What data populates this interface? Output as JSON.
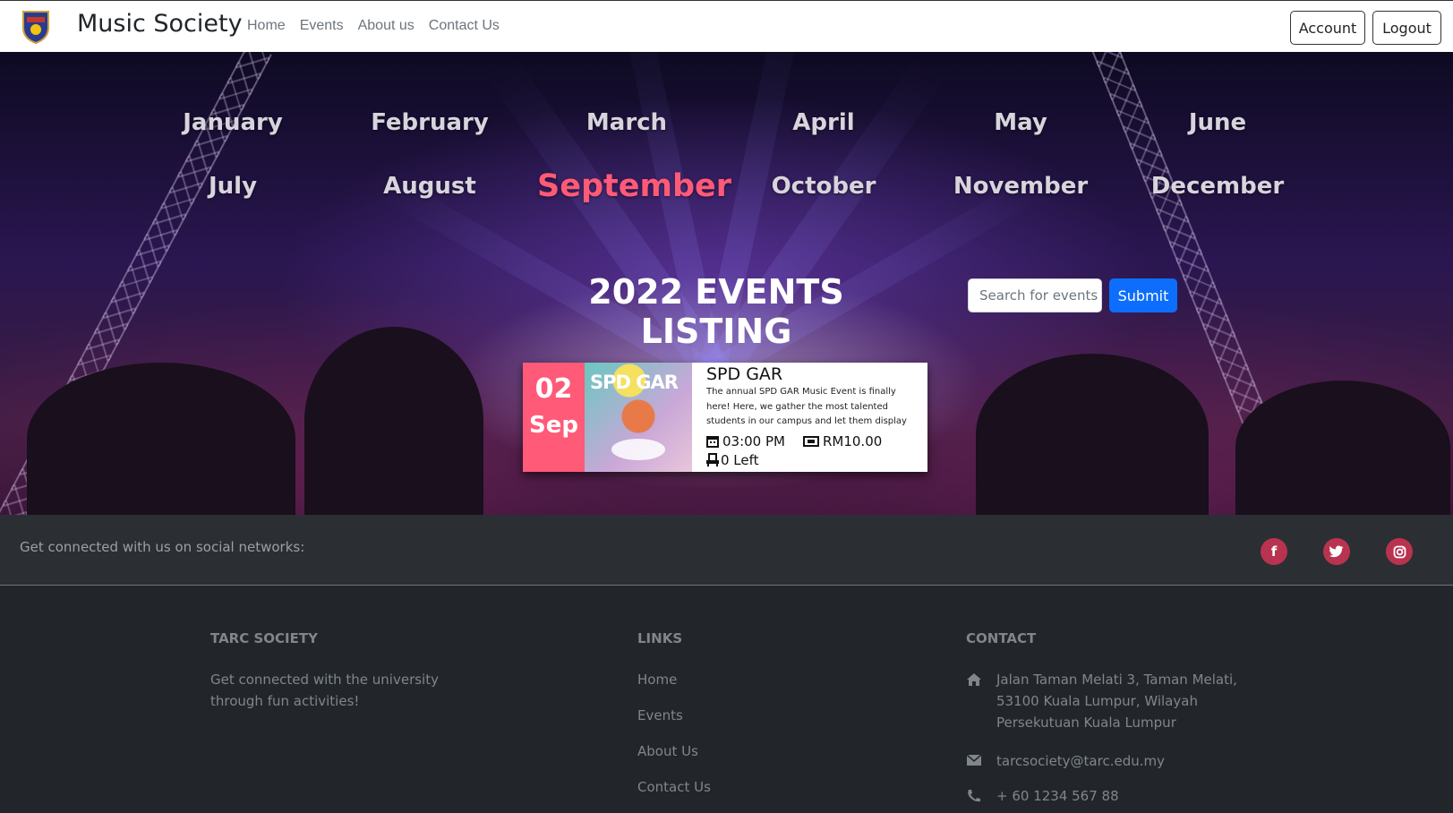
{
  "navbar": {
    "brand": "Music Society",
    "links": [
      "Home",
      "Events",
      "About us",
      "Contact Us"
    ],
    "account_label": "Account",
    "logout_label": "Logout"
  },
  "months": [
    "January",
    "February",
    "March",
    "April",
    "May",
    "June",
    "July",
    "August",
    "September",
    "October",
    "November",
    "December"
  ],
  "active_month": "September",
  "listing_title": "2022 EVENTS LISTING",
  "search": {
    "placeholder": "Search for events",
    "submit_label": "Submit"
  },
  "event": {
    "day": "02",
    "month": "Sep",
    "image_text": "SPD GAR",
    "title": "SPD GAR",
    "description": "The annual SPD GAR Music Event is finally here! Here, we gather the most talented students in our campus and let them display",
    "time": "03:00 PM",
    "price": "RM10.00",
    "seats_left": "0 Left"
  },
  "social": {
    "text": "Get connected with us on social networks:",
    "icons": [
      "facebook-icon",
      "twitter-icon",
      "instagram-icon"
    ]
  },
  "footer": {
    "society": {
      "title": "TARC SOCIETY",
      "text": "Get connected with the university through fun activities!"
    },
    "links": {
      "title": "LINKS",
      "items": [
        "Home",
        "Events",
        "About Us",
        "Contact Us"
      ]
    },
    "contact": {
      "title": "CONTACT",
      "address": "Jalan Taman Melati 3, Taman Melati, 53100 Kuala Lumpur, Wilayah Persekutuan Kuala Lumpur",
      "email": "tarcsociety@tarc.edu.my",
      "phone": "+ 60 1234 567 88"
    }
  },
  "colors": {
    "accent": "#ff5a78",
    "primary": "#0d6efd",
    "social": "#b8334f"
  }
}
